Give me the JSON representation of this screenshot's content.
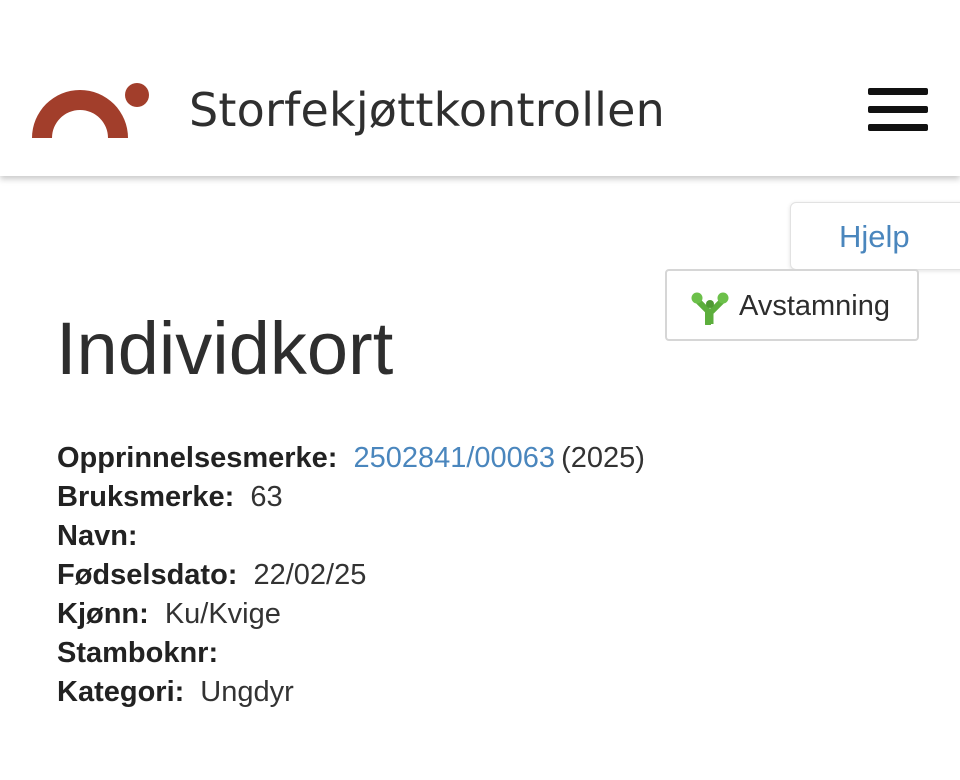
{
  "header": {
    "site_title": "Storfekjøttkontrollen",
    "logo_color": "#a23e2b",
    "menu_icon": "hamburger-menu-icon"
  },
  "help_tab": {
    "label": "Hjelp"
  },
  "pedigree_button": {
    "label": "Avstamning",
    "icon": "pedigree-tree-icon"
  },
  "page": {
    "title": "Individkort"
  },
  "details": {
    "origin_mark_label": "Opprinnelsesmerke:",
    "origin_mark_value": "2502841/00063",
    "origin_mark_year": "(2025)",
    "usage_mark_label": "Bruksmerke:",
    "usage_mark_value": "63",
    "name_label": "Navn:",
    "name_value": "",
    "birth_date_label": "Fødselsdato:",
    "birth_date_value": "22/02/25",
    "sex_label": "Kjønn:",
    "sex_value": "Ku/Kvige",
    "herdbook_label": "Stamboknr:",
    "herdbook_value": "",
    "category_label": "Kategori:",
    "category_value": "Ungdyr"
  },
  "colors": {
    "link": "#4a86bd",
    "icon_green": "#5cae3c",
    "text": "#2b2b2b"
  }
}
